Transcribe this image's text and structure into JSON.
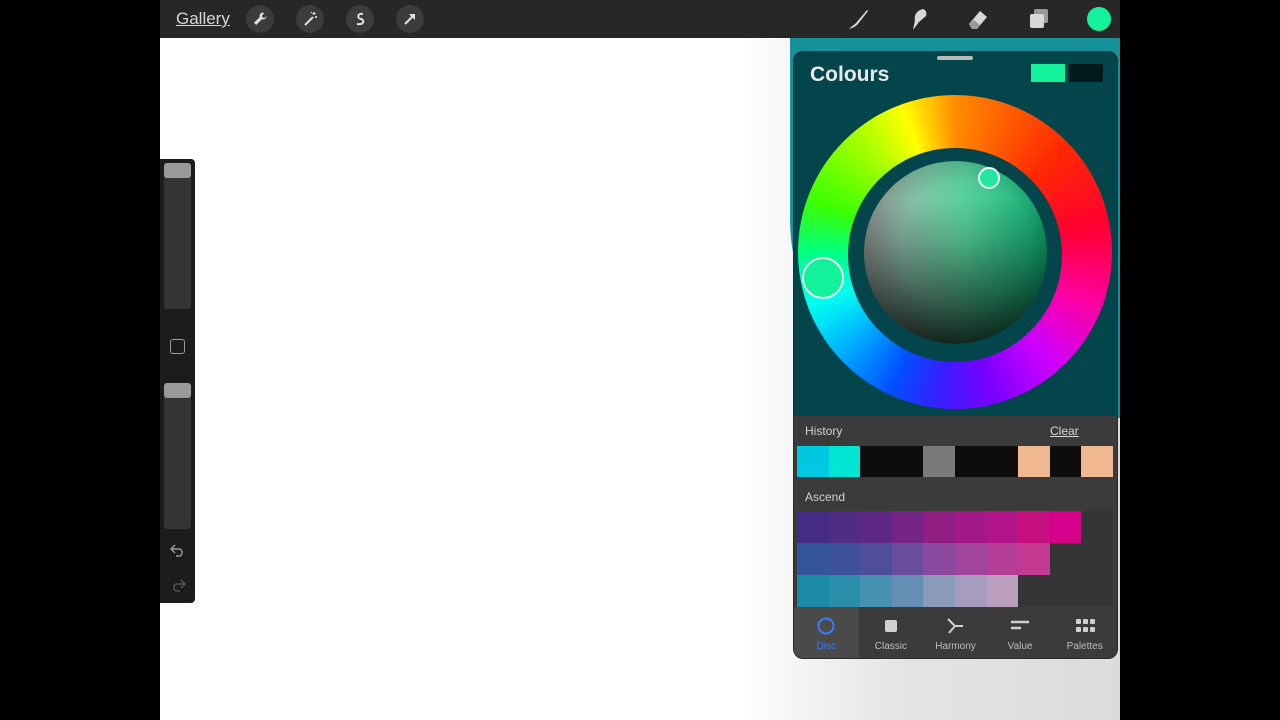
{
  "topbar": {
    "gallery_label": "Gallery",
    "left_tools": [
      "wrench-icon",
      "magic-wand-icon",
      "selection-icon",
      "transform-arrow-icon"
    ],
    "right_tools": [
      "brush-icon",
      "smudge-icon",
      "eraser-icon",
      "layers-icon"
    ],
    "current_color": "#13f29b"
  },
  "panel": {
    "title": "Colours",
    "primary_color": "#13f29b",
    "secondary_color": "#021a1c",
    "history": {
      "label": "History",
      "clear_label": "Clear",
      "swatches": [
        "#00c8e0",
        "#00e6d2",
        "#0d0d0d",
        "#0d0d0d",
        "#7a7a7a",
        "#0d0d0d",
        "#0d0d0d",
        "#f0b890",
        "#0d0d0d",
        "#f0b890"
      ]
    },
    "palette": {
      "name": "Ascend",
      "rows": [
        [
          "#442c84",
          "#512c84",
          "#5e2885",
          "#742485",
          "#901e83",
          "#a5188a",
          "#b4148a",
          "#c6107f",
          "#d6008c"
        ],
        [
          "#35559a",
          "#3d5298",
          "#4f4e9a",
          "#6a4e9e",
          "#8b4aa0",
          "#a1449c",
          "#b43e96",
          "#c43a92"
        ],
        [
          "#1b8aa4",
          "#2a8eab",
          "#4690b0",
          "#668fb5",
          "#8a9ab9",
          "#a59cbe",
          "#bc9fbe"
        ]
      ]
    },
    "tabs": [
      {
        "label": "Disc",
        "icon": "disc-icon",
        "active": true
      },
      {
        "label": "Classic",
        "icon": "classic-icon",
        "active": false
      },
      {
        "label": "Harmony",
        "icon": "harmony-icon",
        "active": false
      },
      {
        "label": "Value",
        "icon": "value-icon",
        "active": false
      },
      {
        "label": "Palettes",
        "icon": "palettes-icon",
        "active": false
      }
    ]
  },
  "sidebar": {
    "tools": [
      "brush-size-slider",
      "modify-button",
      "opacity-slider",
      "undo-icon",
      "redo-icon"
    ]
  }
}
